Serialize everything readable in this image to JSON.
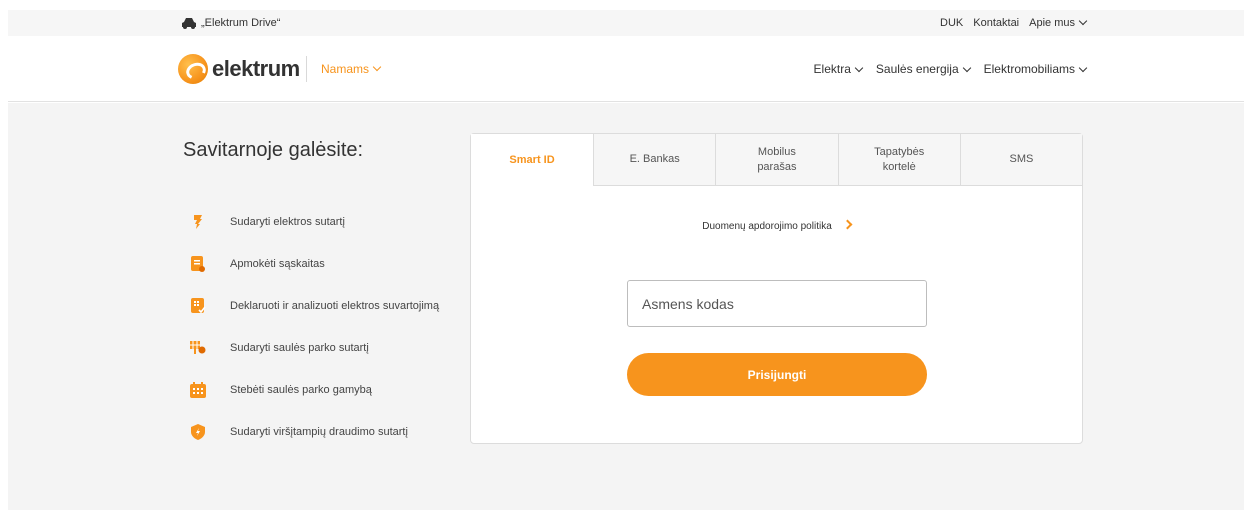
{
  "topbar": {
    "drive_label": "„Elektrum Drive“",
    "links": [
      "DUK",
      "Kontaktai",
      "Apie mus"
    ]
  },
  "header": {
    "logo_text": "elektrum",
    "segment": "Namams",
    "nav": [
      "Elektra",
      "Saulės energija",
      "Elektromobiliams"
    ]
  },
  "left": {
    "title": "Savitarnoje galėsite:",
    "features": [
      {
        "label": "Sudaryti elektros sutartį",
        "icon": "bulb-icon"
      },
      {
        "label": "Apmokėti sąskaitas",
        "icon": "invoice-icon"
      },
      {
        "label": "Deklaruoti ir analizuoti elektros suvartojimą",
        "icon": "meter-icon"
      },
      {
        "label": "Sudaryti saulės parko sutartį",
        "icon": "solar-panel-icon"
      },
      {
        "label": "Stebėti saulės parko gamybą",
        "icon": "calendar-icon"
      },
      {
        "label": "Sudaryti viršįtampių draudimo sutartį",
        "icon": "shield-icon"
      }
    ]
  },
  "login": {
    "tabs": [
      {
        "label": "Smart ID",
        "active": true
      },
      {
        "label": "E. Bankas",
        "active": false
      },
      {
        "label": "Mobilus parašas",
        "active": false
      },
      {
        "label": "Tapatybės kortelė",
        "active": false
      },
      {
        "label": "SMS",
        "active": false
      }
    ],
    "policy_link": "Duomenų apdorojimo politika",
    "input_placeholder": "Asmens kodas",
    "input_value": "",
    "submit_label": "Prisijungti"
  },
  "colors": {
    "accent": "#f7941d",
    "background": "#f4f4f4",
    "card": "#ffffff"
  }
}
